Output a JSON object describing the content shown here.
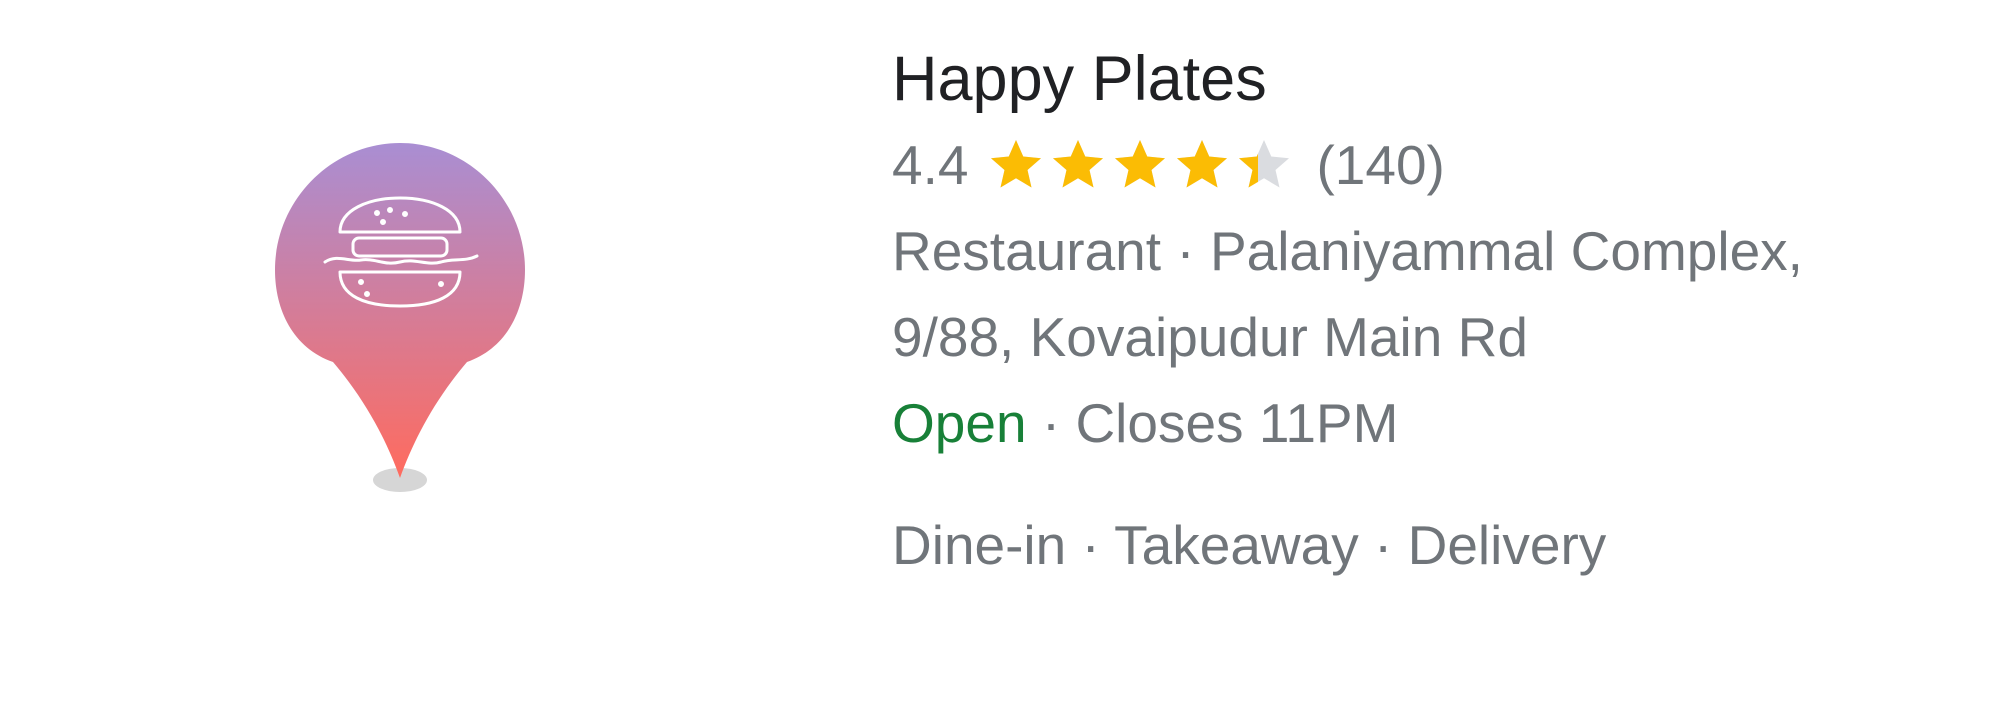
{
  "place": {
    "name": "Happy Plates",
    "rating": "4.4",
    "rating_value": 4.4,
    "review_count": "(140)",
    "category": "Restaurant",
    "separator": "·",
    "address_line1": "Palaniyammal Complex,",
    "address_line2": "9/88, Kovaipudur Main Rd",
    "status_open": "Open",
    "closes": "Closes 11PM",
    "services": [
      "Dine-in",
      "Takeaway",
      "Delivery"
    ]
  },
  "icons": {
    "marker": "map-pin-icon",
    "marker_glyph": "burger-icon",
    "star": "star-icon"
  },
  "colors": {
    "pin_top": "#a98ed3",
    "pin_bottom": "#ff6b5e",
    "star_fill": "#fbbc04",
    "star_empty": "#dadce0",
    "open": "#188038",
    "text_secondary": "#70757a",
    "title": "#202124"
  }
}
